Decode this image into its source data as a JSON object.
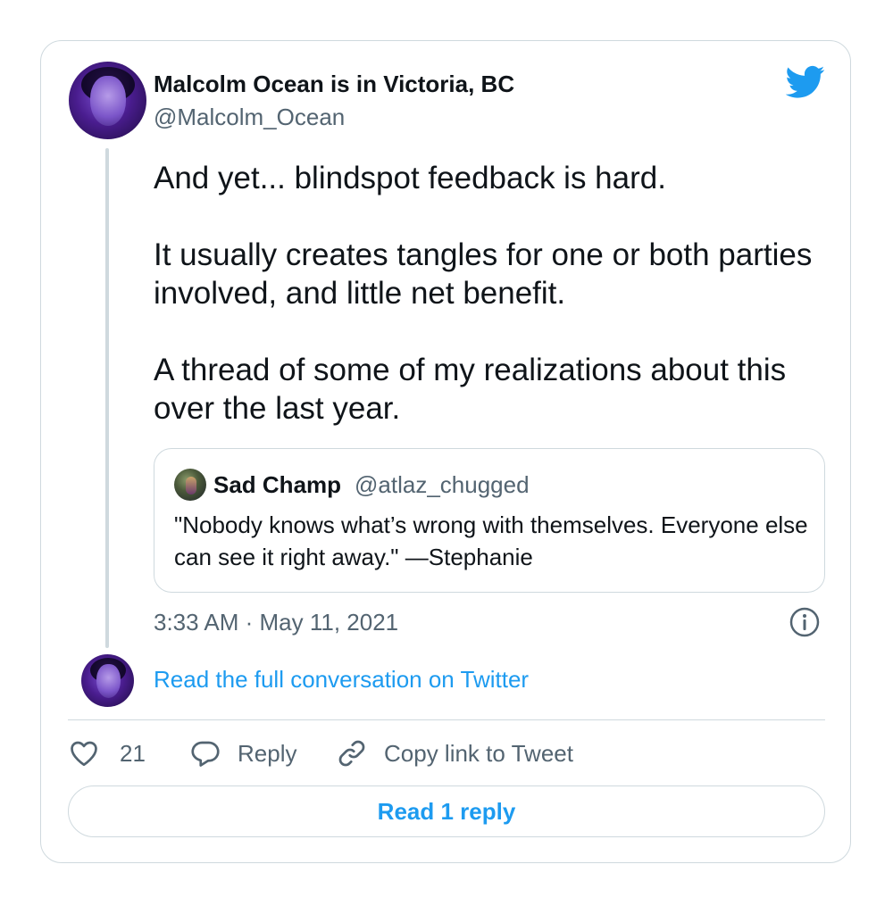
{
  "tweet": {
    "author_name": "Malcolm Ocean is in Victoria, BC",
    "author_handle": "@Malcolm_Ocean",
    "paragraphs": [
      "And yet... blindspot feedback is hard.",
      "It usually creates tangles for one or both parties involved, and little net benefit.",
      "A thread of some of my realizations about this over the last year."
    ],
    "timestamp": "3:33 AM · May 11, 2021"
  },
  "quote": {
    "name": "Sad Champ",
    "handle": "@atlaz_chugged",
    "text": "\"Nobody knows what’s wrong with themselves. Everyone else can see it right away.\" —Stephanie"
  },
  "links": {
    "read_conversation": "Read the full conversation on Twitter"
  },
  "actions": {
    "like_count": "21",
    "reply_label": "Reply",
    "copy_label": "Copy link to Tweet",
    "read_replies_label": "Read 1 reply"
  },
  "colors": {
    "accent": "#1d9bf0",
    "secondary_text": "#536471",
    "border": "#cfd9de"
  },
  "icons": [
    "twitter-bird-icon",
    "info-icon",
    "heart-icon",
    "comment-bubble-icon",
    "link-icon"
  ]
}
